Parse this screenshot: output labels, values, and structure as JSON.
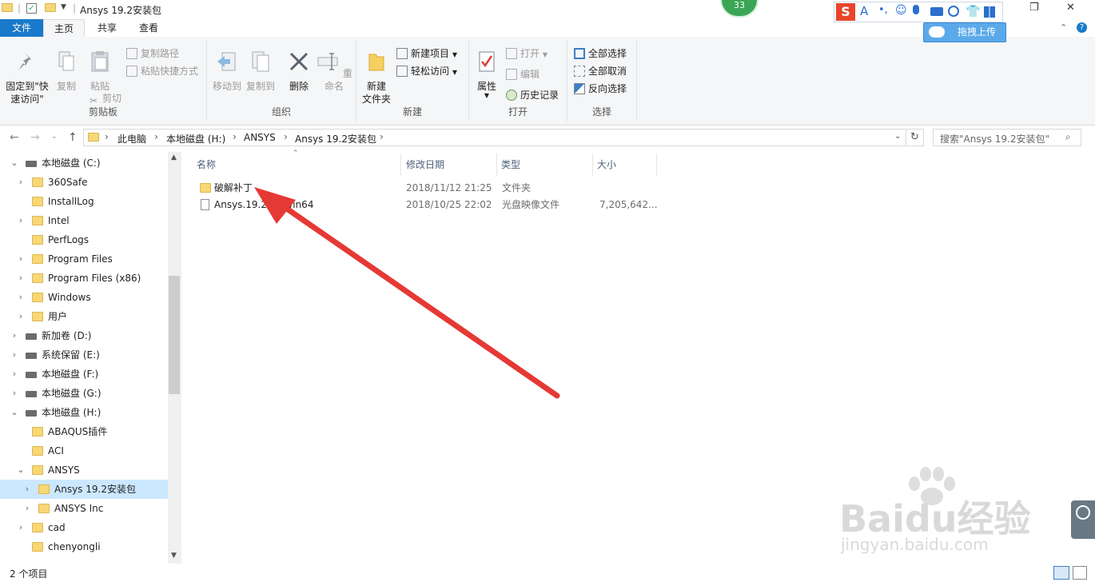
{
  "window": {
    "title": "Ansys 19.2安装包",
    "controls": {
      "restore": "❐",
      "close": "✕"
    }
  },
  "ribbon_tabs": [
    "文件",
    "主页",
    "共享",
    "查看"
  ],
  "ribbon": {
    "clipboard": {
      "pin_label": "固定到\"快速访问\"",
      "copy_label": "复制",
      "paste_label": "粘贴",
      "copy_path_label": "复制路径",
      "paste_shortcut_label": "粘贴快捷方式",
      "cut_label": "剪切",
      "group_label": "剪贴板"
    },
    "organize": {
      "move_label": "移动到",
      "copyto_label": "复制到",
      "delete_label": "删除",
      "rename_label": "重命名",
      "group_label": "组织"
    },
    "new": {
      "new_folder_label": "新建\n文件夹",
      "new_item_label": "新建项目",
      "easy_access_label": "轻松访问",
      "group_label": "新建"
    },
    "open": {
      "properties_label": "属性",
      "open_label": "打开",
      "edit_label": "编辑",
      "history_label": "历史记录",
      "group_label": "打开"
    },
    "select": {
      "select_all_label": "全部选择",
      "select_none_label": "全部取消",
      "invert_label": "反向选择",
      "group_label": "选择"
    }
  },
  "address": {
    "crumbs": [
      "此电脑",
      "本地磁盘 (H:)",
      "ANSYS",
      "Ansys 19.2安装包"
    ],
    "search_placeholder": "搜索\"Ansys 19.2安装包\""
  },
  "nav_tree": [
    {
      "label": "本地磁盘 (C:)",
      "type": "drive",
      "level": 0,
      "expander": "open"
    },
    {
      "label": "360Safe",
      "type": "folder",
      "level": 1,
      "expander": "closed"
    },
    {
      "label": "InstallLog",
      "type": "folder",
      "level": 1,
      "expander": "none"
    },
    {
      "label": "Intel",
      "type": "folder",
      "level": 1,
      "expander": "closed"
    },
    {
      "label": "PerfLogs",
      "type": "folder",
      "level": 1,
      "expander": "none"
    },
    {
      "label": "Program Files",
      "type": "folder",
      "level": 1,
      "expander": "closed"
    },
    {
      "label": "Program Files (x86)",
      "type": "folder",
      "level": 1,
      "expander": "closed"
    },
    {
      "label": "Windows",
      "type": "folder",
      "level": 1,
      "expander": "closed"
    },
    {
      "label": "用户",
      "type": "folder",
      "level": 1,
      "expander": "closed"
    },
    {
      "label": "新加卷 (D:)",
      "type": "drive",
      "level": 0,
      "expander": "closed"
    },
    {
      "label": "系统保留 (E:)",
      "type": "drive",
      "level": 0,
      "expander": "closed"
    },
    {
      "label": "本地磁盘 (F:)",
      "type": "drive",
      "level": 0,
      "expander": "closed"
    },
    {
      "label": "本地磁盘 (G:)",
      "type": "drive",
      "level": 0,
      "expander": "closed"
    },
    {
      "label": "本地磁盘 (H:)",
      "type": "drive",
      "level": 0,
      "expander": "open"
    },
    {
      "label": "ABAQUS插件",
      "type": "folder",
      "level": 1,
      "expander": "none"
    },
    {
      "label": "ACI",
      "type": "folder",
      "level": 1,
      "expander": "none"
    },
    {
      "label": "ANSYS",
      "type": "folder",
      "level": 1,
      "expander": "open"
    },
    {
      "label": "Ansys 19.2安装包",
      "type": "folder",
      "level": 2,
      "expander": "closed",
      "selected": true
    },
    {
      "label": "ANSYS Inc",
      "type": "folder",
      "level": 2,
      "expander": "closed"
    },
    {
      "label": "cad",
      "type": "folder",
      "level": 1,
      "expander": "closed"
    },
    {
      "label": "chenyongli",
      "type": "folder",
      "level": 1,
      "expander": "none"
    }
  ],
  "file_columns": [
    "名称",
    "修改日期",
    "类型",
    "大小"
  ],
  "files": [
    {
      "name": "破解补丁",
      "date": "2018/11/12 21:25",
      "type": "文件夹",
      "size": "",
      "icon": "folder"
    },
    {
      "name": "Ansys.19.2.  D.Win64",
      "date": "2018/10/25 22:02",
      "type": "光盘映像文件",
      "size": "7,205,642...",
      "icon": "file"
    }
  ],
  "status": {
    "item_count": "2 个项目"
  },
  "overlays": {
    "badge_number": "33",
    "upload_label": "拖拽上传",
    "watermark_text": "Baidu经验",
    "watermark_url": "jingyan.baidu.com",
    "arrow_color": "#e53935"
  }
}
